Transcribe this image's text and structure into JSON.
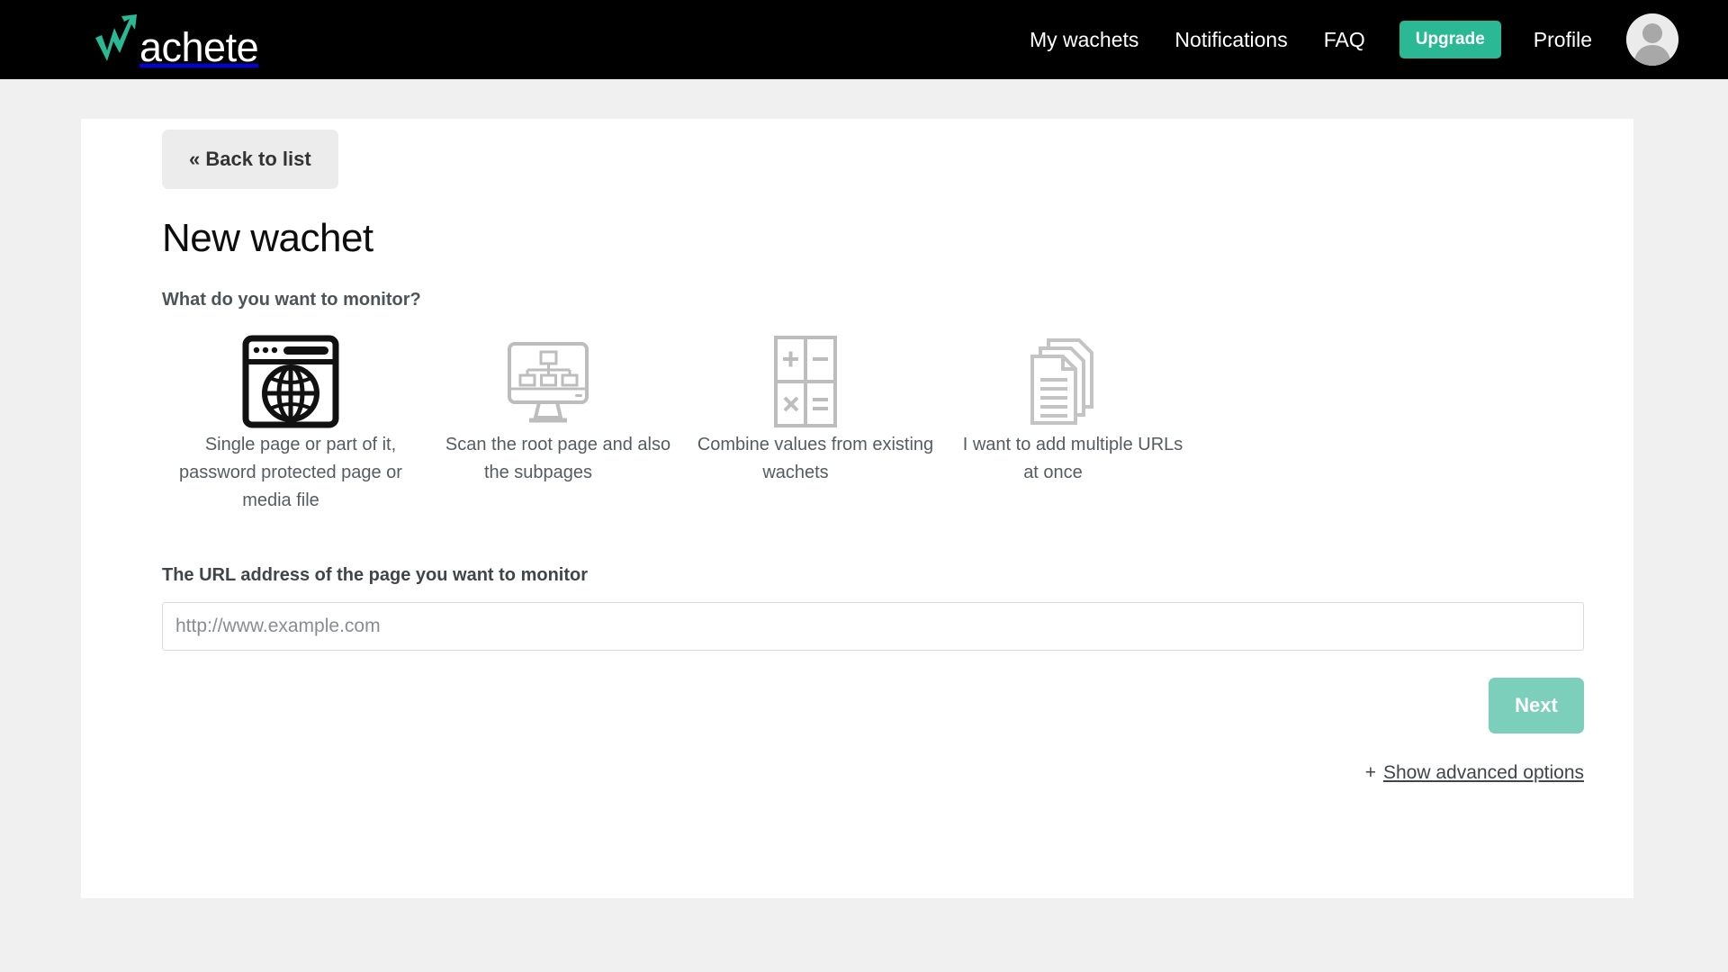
{
  "header": {
    "logo_text": "achete",
    "logo_initial": "W",
    "nav": [
      {
        "label": "My wachets",
        "name": "nav-my-wachets"
      },
      {
        "label": "Notifications",
        "name": "nav-notifications"
      },
      {
        "label": "FAQ",
        "name": "nav-faq"
      }
    ],
    "upgrade_label": "Upgrade",
    "profile_label": "Profile",
    "accent_color": "#2bb894",
    "bar_color": "#000000"
  },
  "main": {
    "back_label": "« Back to list",
    "title": "New wachet",
    "question": "What do you want to monitor?",
    "options": [
      {
        "label": "Single page or part of it, password protected page or media file",
        "icon": "browser-globe-icon",
        "selected": true
      },
      {
        "label": "Scan the root page and also the subpages",
        "icon": "monitor-sitemap-icon",
        "selected": false
      },
      {
        "label": "Combine values from existing wachets",
        "icon": "calculator-operators-icon",
        "selected": false
      },
      {
        "label": "I want to add multiple URLs at once",
        "icon": "stacked-documents-icon",
        "selected": false
      }
    ],
    "url_field": {
      "label": "The URL address of the page you want to monitor",
      "placeholder": "http://www.example.com",
      "value": ""
    },
    "next_label": "Next",
    "advanced": {
      "plus": "+",
      "label": "Show advanced options"
    }
  }
}
